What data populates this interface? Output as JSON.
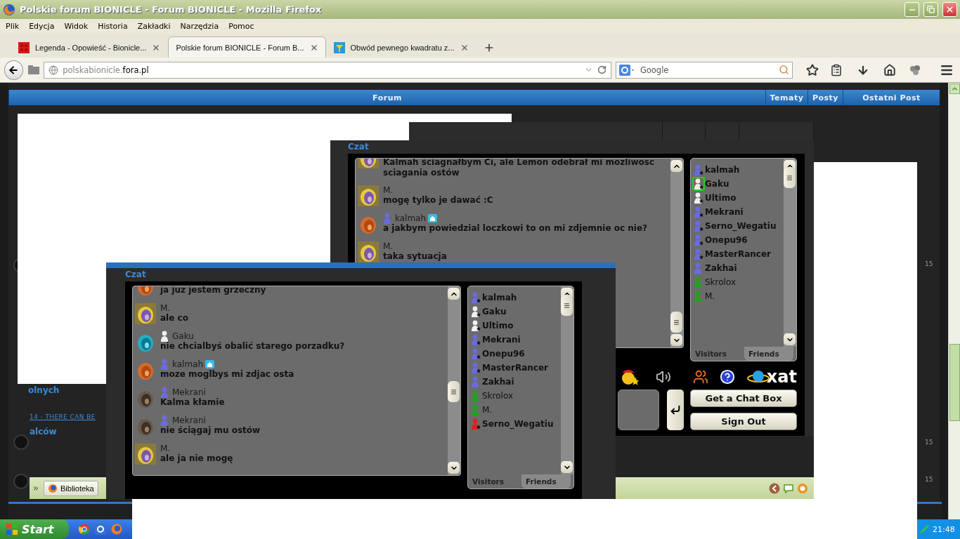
{
  "window": {
    "title": "Polskie forum BIONICLE - Forum BIONICLE - Mozilla Firefox"
  },
  "menu": [
    "Plik",
    "Edycja",
    "Widok",
    "Historia",
    "Zakładki",
    "Narzędzia",
    "Pomoc"
  ],
  "tabs": [
    {
      "label": "Legenda - Opowieść - Bionicle...",
      "selected": false,
      "kind": "brick"
    },
    {
      "label": "Polskie forum BIONICLE - Forum B...",
      "selected": true,
      "kind": "plain"
    },
    {
      "label": "Obwód pewnego kwadratu z...",
      "selected": false,
      "kind": "funnel"
    }
  ],
  "address": {
    "host_prefix": "polskabionicle.",
    "host_domain": "fora.pl"
  },
  "search": {
    "placeholder": "Google"
  },
  "forum": {
    "columns": [
      "Forum",
      "Tematy",
      "Posty",
      "Ostatni Post"
    ],
    "fragments": [
      {
        "kind": "heading",
        "text": "olnych"
      },
      {
        "kind": "link",
        "text": "14 - THERE CAN BE"
      },
      {
        "kind": "heading",
        "text": "alców"
      },
      {
        "kind": "count",
        "text": "15"
      },
      {
        "kind": "count",
        "text": "15"
      },
      {
        "kind": "count",
        "text": "15"
      }
    ]
  },
  "chats": [
    {
      "label": "Czat",
      "messages": [
        {
          "kind": "portrait",
          "text": "Kalmah ściagnałbym Ci, ale Lemon odebrał mi mozliwosc sciagania ostów",
          "home": false
        },
        {
          "kind": "portrait",
          "name": "M.",
          "text": "mogę tylko je dawać :C",
          "home": false
        },
        {
          "kind": "dog",
          "name": "kalmah",
          "color": "#6b6be0",
          "home": true,
          "text": "a jakbym powiedzial loczkowi to on mi zdjemnie oc nie?"
        },
        {
          "kind": "portrait",
          "name": "M.",
          "text": "taka sytuacja",
          "home": false
        }
      ],
      "users": [
        {
          "name": "kalmah",
          "color": "#6b6be0",
          "star": true,
          "registered": true,
          "selected": false
        },
        {
          "name": "Gaku",
          "color": "#f0f0f0",
          "star": true,
          "registered": true,
          "selected": true
        },
        {
          "name": "Ultimo",
          "color": "#f0f0f0",
          "star": true,
          "registered": true,
          "selected": false
        },
        {
          "name": "Mekrani",
          "color": "#6b6be0",
          "star": true,
          "registered": true,
          "selected": false
        },
        {
          "name": "Serno_Wegatiu",
          "color": "#6b6be0",
          "star": true,
          "registered": true,
          "selected": false
        },
        {
          "name": "Onepu96",
          "color": "#6b6be0",
          "star": true,
          "registered": true,
          "selected": false
        },
        {
          "name": "MasterRancer",
          "color": "#6b6be0",
          "star": true,
          "registered": true,
          "selected": false
        },
        {
          "name": "Zakhai",
          "color": "#6b6be0",
          "star": false,
          "registered": true,
          "selected": false
        },
        {
          "name": "Skrolox",
          "color": "#22a022",
          "star": false,
          "registered": false,
          "selected": false
        },
        {
          "name": "M.",
          "color": "#22a022",
          "star": false,
          "registered": false,
          "selected": false
        }
      ],
      "list_tabs": [
        {
          "label": "Visitors",
          "selected": true
        },
        {
          "label": "Friends",
          "selected": false
        }
      ],
      "logo": "xat",
      "buttons": [
        "Get a Chat Box",
        "Sign Out"
      ]
    },
    {
      "label": "Czat",
      "messages": [
        {
          "kind": "dog",
          "text": "ja juz jestem grzeczny",
          "home": false
        },
        {
          "kind": "portrait",
          "name": "M.",
          "text": "ale co",
          "home": false
        },
        {
          "kind": "mask",
          "name": "Gaku",
          "color": "#f0f0f0",
          "home": false,
          "text": "nie chcialbyś obalić starego porzadku?"
        },
        {
          "kind": "dog",
          "name": "kalmah",
          "color": "#6b6be0",
          "home": true,
          "text": "moze moglbys mi zdjac osta"
        },
        {
          "kind": "gear",
          "name": "Mekrani",
          "color": "#6b6be0",
          "home": false,
          "text": "Kalma kłamie"
        },
        {
          "kind": "gear",
          "name": "Mekrani",
          "color": "#6b6be0",
          "home": false,
          "text": "nie ściągaj mu ostów"
        },
        {
          "kind": "portrait",
          "name": "M.",
          "text": "ale ja nie mogę",
          "home": false
        }
      ],
      "users": [
        {
          "name": "kalmah",
          "color": "#6b6be0",
          "star": true,
          "registered": true,
          "selected": false
        },
        {
          "name": "Gaku",
          "color": "#f0f0f0",
          "star": true,
          "registered": true,
          "selected": false
        },
        {
          "name": "Ultimo",
          "color": "#f0f0f0",
          "star": true,
          "registered": true,
          "selected": false
        },
        {
          "name": "Mekrani",
          "color": "#6b6be0",
          "star": true,
          "registered": true,
          "selected": false
        },
        {
          "name": "Onepu96",
          "color": "#6b6be0",
          "star": true,
          "registered": true,
          "selected": false
        },
        {
          "name": "MasterRancer",
          "color": "#6b6be0",
          "star": true,
          "registered": true,
          "selected": false
        },
        {
          "name": "Zakhai",
          "color": "#6b6be0",
          "star": false,
          "registered": true,
          "selected": false
        },
        {
          "name": "Skrolox",
          "color": "#22a022",
          "star": false,
          "registered": false,
          "selected": false
        },
        {
          "name": "M.",
          "color": "#22a022",
          "star": false,
          "registered": false,
          "selected": false
        },
        {
          "name": "Serno_Wegatiu",
          "color": "#e02020",
          "star": true,
          "registered": true,
          "selected": false
        }
      ],
      "list_tabs": [
        {
          "label": "Visitors",
          "selected": true
        },
        {
          "label": "Friends",
          "selected": false
        }
      ]
    }
  ],
  "downloads_bar": {
    "button": "Biblioteka"
  },
  "taskbar": {
    "start": "Start",
    "clock": "21:48"
  }
}
